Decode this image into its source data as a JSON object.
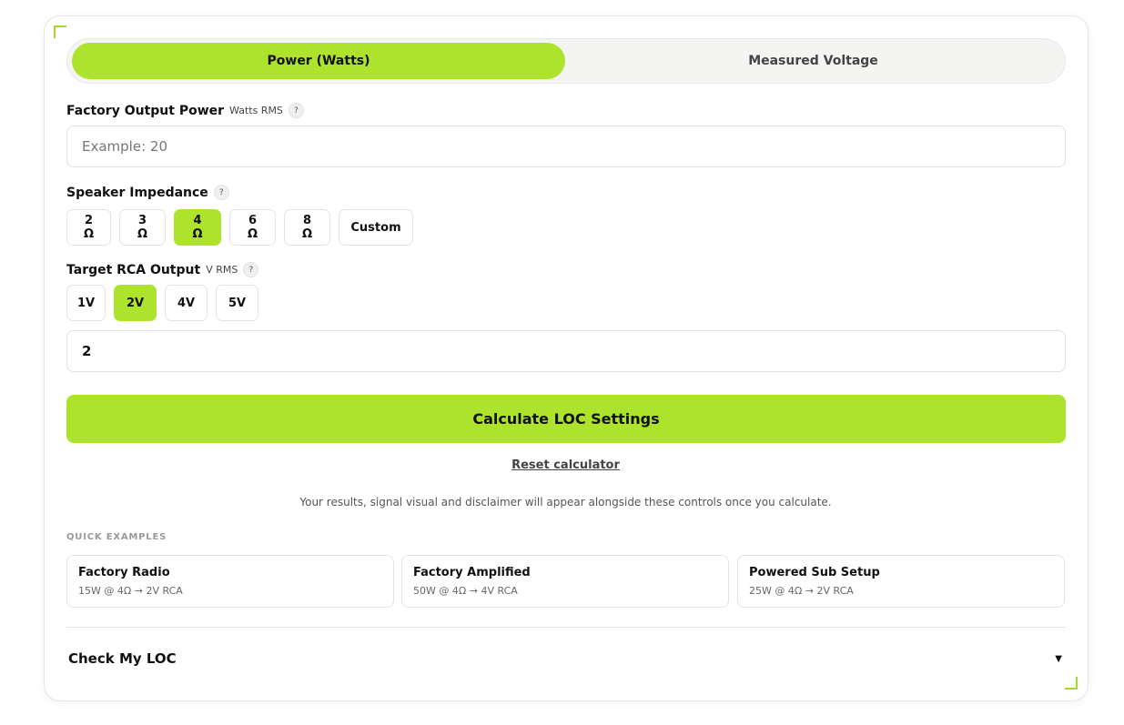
{
  "mode_tabs": [
    {
      "label": "Power (Watts)",
      "active": true
    },
    {
      "label": "Measured Voltage",
      "active": false
    }
  ],
  "factory_power": {
    "label": "Factory Output Power",
    "unit": "Watts RMS",
    "help": "?",
    "placeholder": "Example: 20",
    "value": ""
  },
  "impedance": {
    "label": "Speaker Impedance",
    "help": "?",
    "options": [
      "2 Ω",
      "3 Ω",
      "4 Ω",
      "6 Ω",
      "8 Ω",
      "Custom"
    ],
    "selected": "4 Ω"
  },
  "rca": {
    "label": "Target RCA Output",
    "unit": "V RMS",
    "help": "?",
    "options": [
      "1V",
      "2V",
      "4V",
      "5V"
    ],
    "selected": "2V",
    "value": "2"
  },
  "calculate_label": "Calculate LOC Settings",
  "reset_label": "Reset calculator",
  "info_text": "Your results, signal visual and disclaimer will appear alongside these controls once you calculate.",
  "quick_examples": {
    "title": "QUICK EXAMPLES",
    "items": [
      {
        "title": "Factory Radio",
        "subtitle": "15W @ 4Ω → 2V RCA"
      },
      {
        "title": "Factory Amplified",
        "subtitle": "50W @ 4Ω → 4V RCA"
      },
      {
        "title": "Powered Sub Setup",
        "subtitle": "25W @ 4Ω → 2V RCA"
      }
    ]
  },
  "check_loc": {
    "title": "Check My LOC",
    "chevron": "▼"
  },
  "colors": {
    "accent": "#ade32d",
    "corner": "#a8d92a"
  }
}
